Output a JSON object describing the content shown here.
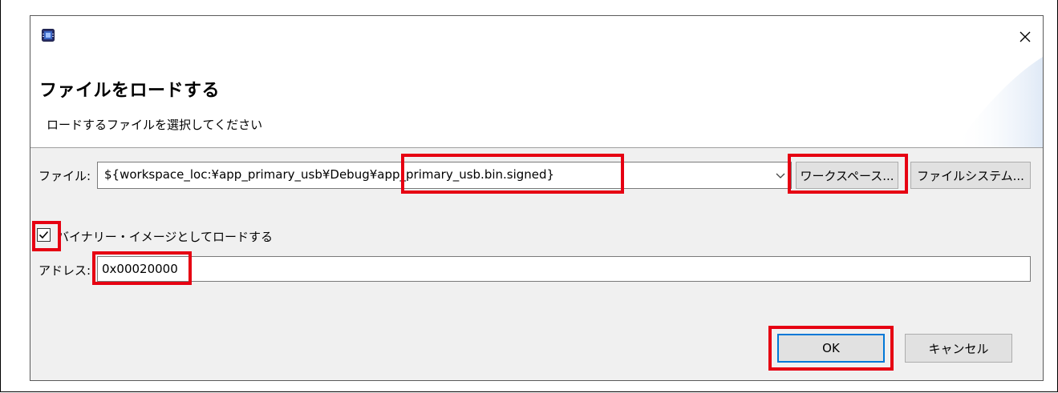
{
  "dialog": {
    "title": "ファイルをロードする",
    "subtitle": "ロードするファイルを選択してください",
    "close_symbol": "×",
    "icon": "renesas-e2-app-icon"
  },
  "form": {
    "file_label": "ファイル:",
    "file_value": "${workspace_loc:¥app_primary_usb¥Debug¥app_primary_usb.bin.signed}",
    "workspace_button": "ワークスペース...",
    "filesystem_button": "ファイルシステム...",
    "binary_checkbox_label": "バイナリー・イメージとしてロードする",
    "binary_checked": true,
    "address_label": "アドレス:",
    "address_value": "0x00020000"
  },
  "footer": {
    "ok_label": "OK",
    "cancel_label": "キャンセル"
  },
  "colors": {
    "highlight": "#e60012",
    "dialog_bg": "#f0f0f0",
    "banner_bg": "#ffffff",
    "button_bg": "#e1e1e1",
    "default_button_border": "#0078d7"
  }
}
